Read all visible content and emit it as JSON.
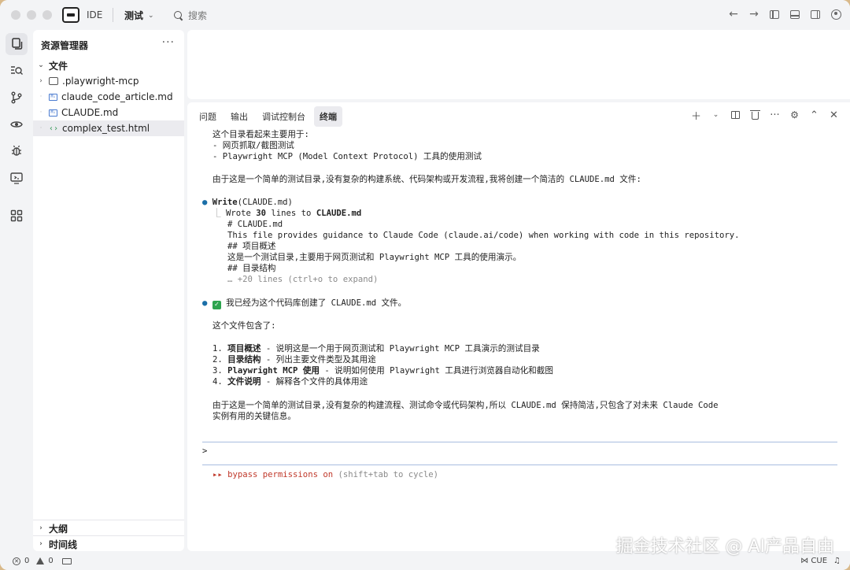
{
  "titlebar": {
    "ide_label": "IDE",
    "project_name": "测试",
    "search_placeholder": "搜索"
  },
  "sidebar": {
    "title": "资源管理器",
    "more": "···",
    "root_folder": "文件",
    "items": [
      {
        "label": ".playwright-mcp",
        "kind": "folder"
      },
      {
        "label": "claude_code_article.md",
        "kind": "md"
      },
      {
        "label": "CLAUDE.md",
        "kind": "md"
      },
      {
        "label": "complex_test.html",
        "kind": "html"
      }
    ],
    "outline": "大纲",
    "timeline": "时间线"
  },
  "panel": {
    "tabs": [
      "问题",
      "输出",
      "调试控制台",
      "终端"
    ],
    "active_tab": "终端"
  },
  "terminal": {
    "lines": {
      "l1": "这个目录看起来主要用于:",
      "l2": "- 网页抓取/截图测试",
      "l3": "- Playwright MCP (Model Context Protocol) 工具的使用测试",
      "l4": "由于这是一个简单的测试目录,没有复杂的构建系统、代码架构或开发流程,我将创建一个简洁的 CLAUDE.md 文件:",
      "write_tool": "Write",
      "write_arg": "(CLAUDE.md)",
      "wrote_prefix": "Wrote ",
      "wrote_count": "30",
      "wrote_mid": " lines to ",
      "wrote_file": "CLAUDE.md",
      "c1": "# CLAUDE.md",
      "c2": "This file provides guidance to Claude Code (claude.ai/code) when working with code in this repository.",
      "c3": "## 项目概述",
      "c4": "这是一个测试目录,主要用于网页测试和 Playwright MCP 工具的使用演示。",
      "c5": "## 目录结构",
      "c6": "… +20 lines (ctrl+o to expand)",
      "done": "我已经为这个代码库创建了 CLAUDE.md 文件。",
      "contains": "这个文件包含了:",
      "i1_num": "1. ",
      "i1_bold": "项目概述",
      "i1_rest": " - 说明这是一个用于网页测试和 Playwright MCP 工具演示的测试目录",
      "i2_num": "2. ",
      "i2_bold": "目录结构",
      "i2_rest": " - 列出主要文件类型及其用途",
      "i3_num": "3. ",
      "i3_bold": "Playwright MCP 使用",
      "i3_rest": " - 说明如何使用 Playwright 工具进行浏览器自动化和截图",
      "i4_num": "4. ",
      "i4_bold": "文件说明",
      "i4_rest": " - 解释各个文件的具体用途",
      "s1": "由于这是一个简单的测试目录,没有复杂的构建流程、测试命令或代码架构,所以 CLAUDE.md 保持简洁,只包含了对未来 Claude Code",
      "s2": "实例有用的关键信息。",
      "prompt": ">",
      "bypass_arrows": "▸▸ ",
      "bypass": "bypass permissions on",
      "bypass_hint": " (shift+tab to cycle)"
    }
  },
  "statusbar": {
    "errors": "0",
    "warnings": "0",
    "cue": "CUE"
  },
  "watermark": "掘金技术社区 @ AI产品自由",
  "colors": {
    "background": "#f3f4f6",
    "accent_blue": "#1b6fa8",
    "check_green": "#2ea44f",
    "bypass_red": "#c0392b"
  }
}
